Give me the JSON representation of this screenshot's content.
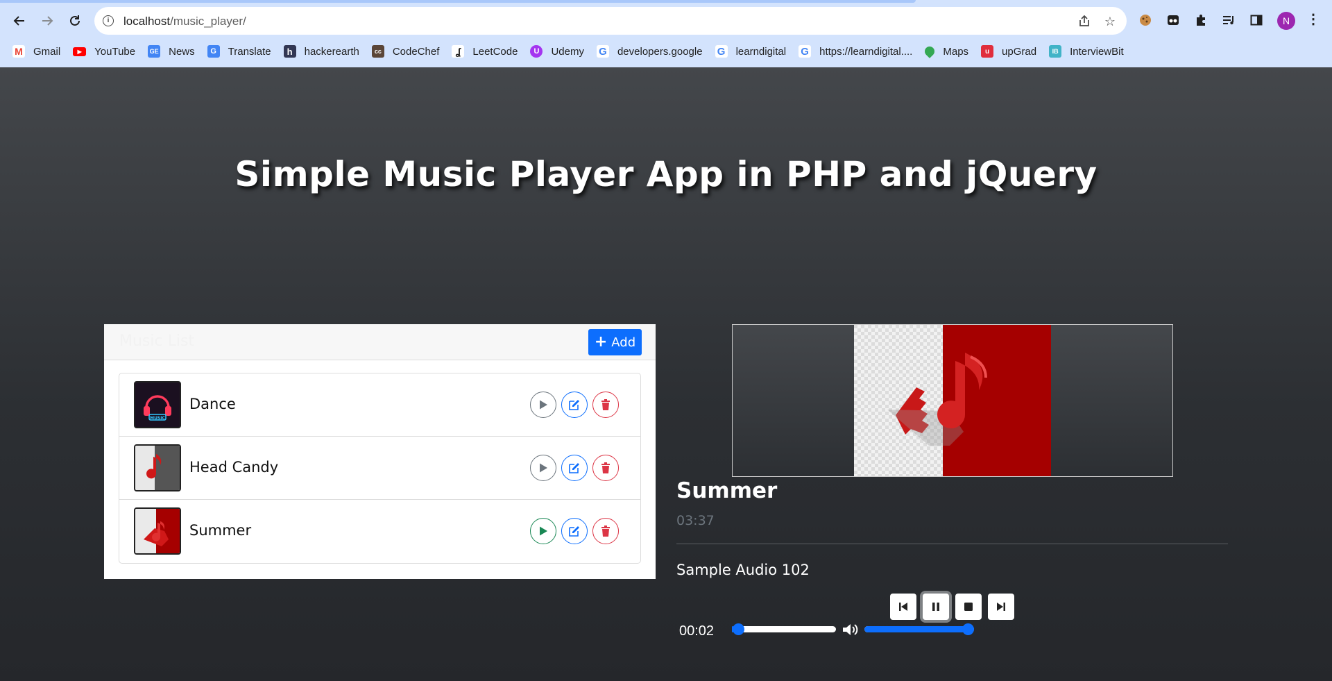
{
  "browser": {
    "url_host": "localhost",
    "url_path": "/music_player/",
    "bookmarks": [
      {
        "label": "Gmail",
        "icon": "gmail-icon",
        "color": "#ea4335"
      },
      {
        "label": "YouTube",
        "icon": "youtube-icon",
        "color": "#ff0000"
      },
      {
        "label": "News",
        "icon": "news-icon",
        "color": "#4285f4"
      },
      {
        "label": "Translate",
        "icon": "translate-icon",
        "color": "#4285f4"
      },
      {
        "label": "hackerearth",
        "icon": "hackerearth-icon",
        "color": "#323754"
      },
      {
        "label": "CodeChef",
        "icon": "codechef-icon",
        "color": "#5b4638"
      },
      {
        "label": "LeetCode",
        "icon": "leetcode-icon",
        "color": "#ffa116"
      },
      {
        "label": "Udemy",
        "icon": "udemy-icon",
        "color": "#a435f0"
      },
      {
        "label": "developers.google",
        "icon": "google-icon",
        "color": "#4285f4"
      },
      {
        "label": "learndigital",
        "icon": "google-icon",
        "color": "#4285f4"
      },
      {
        "label": "https://learndigital....",
        "icon": "google-icon",
        "color": "#4285f4"
      },
      {
        "label": "Maps",
        "icon": "maps-icon",
        "color": "#34a853"
      },
      {
        "label": "upGrad",
        "icon": "upgrad-icon",
        "color": "#e02d3c"
      },
      {
        "label": "InterviewBit",
        "icon": "interviewbit-icon",
        "color": "#41b3c7"
      }
    ],
    "avatar_initial": "N"
  },
  "page": {
    "title": "Simple Music Player App in PHP and jQuery"
  },
  "music_list": {
    "header_title": "Music List",
    "add_label": "Add",
    "items": [
      {
        "title": "Dance",
        "thumb": "neon-headphones",
        "playing": false
      },
      {
        "title": "Head Candy",
        "thumb": "red-music-note",
        "playing": false
      },
      {
        "title": "Summer",
        "thumb": "red-music-note-split",
        "playing": true
      }
    ]
  },
  "player": {
    "song_title": "Summer",
    "duration": "03:37",
    "description": "Sample Audio 102",
    "current_time": "00:02",
    "progress_fraction": 0.01,
    "volume_fraction": 1.0
  },
  "colors": {
    "primary": "#0d6efd",
    "danger": "#dc3545",
    "success": "#198754",
    "secondary": "#6c757d"
  }
}
